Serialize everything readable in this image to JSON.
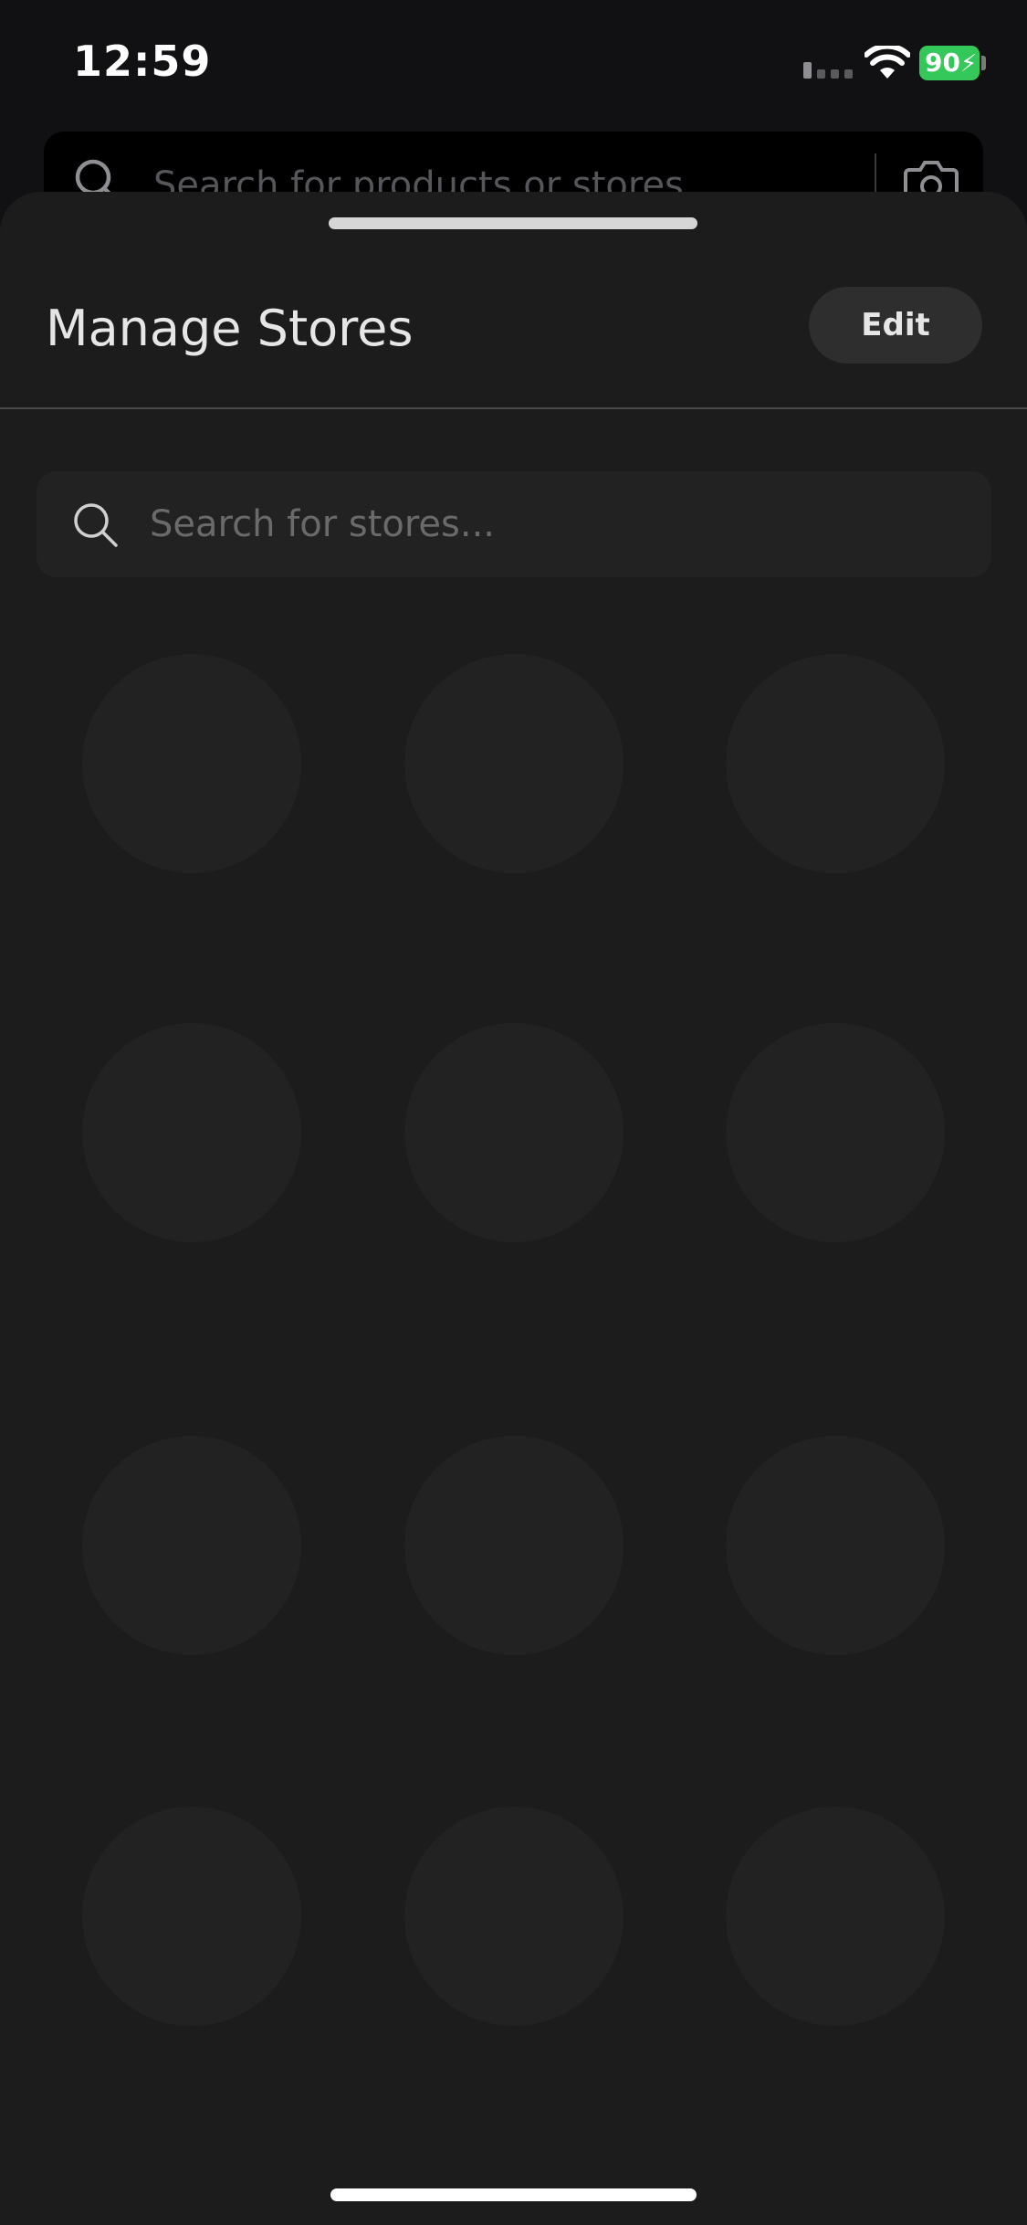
{
  "status_bar": {
    "time": "12:59",
    "battery_level": "90"
  },
  "background": {
    "search_placeholder": "Search for products or stores"
  },
  "sheet": {
    "title": "Manage Stores",
    "edit_label": "Edit",
    "search_placeholder": "Search for stores..."
  },
  "stores": {
    "placeholder_count": 12
  },
  "colors": {
    "background": "#111113",
    "sheet": "#1c1c1c",
    "placeholder": "#222222",
    "battery": "#34c759"
  },
  "icons": [
    "signal-icon",
    "wifi-icon",
    "battery-icon",
    "search-icon",
    "camera-icon"
  ]
}
